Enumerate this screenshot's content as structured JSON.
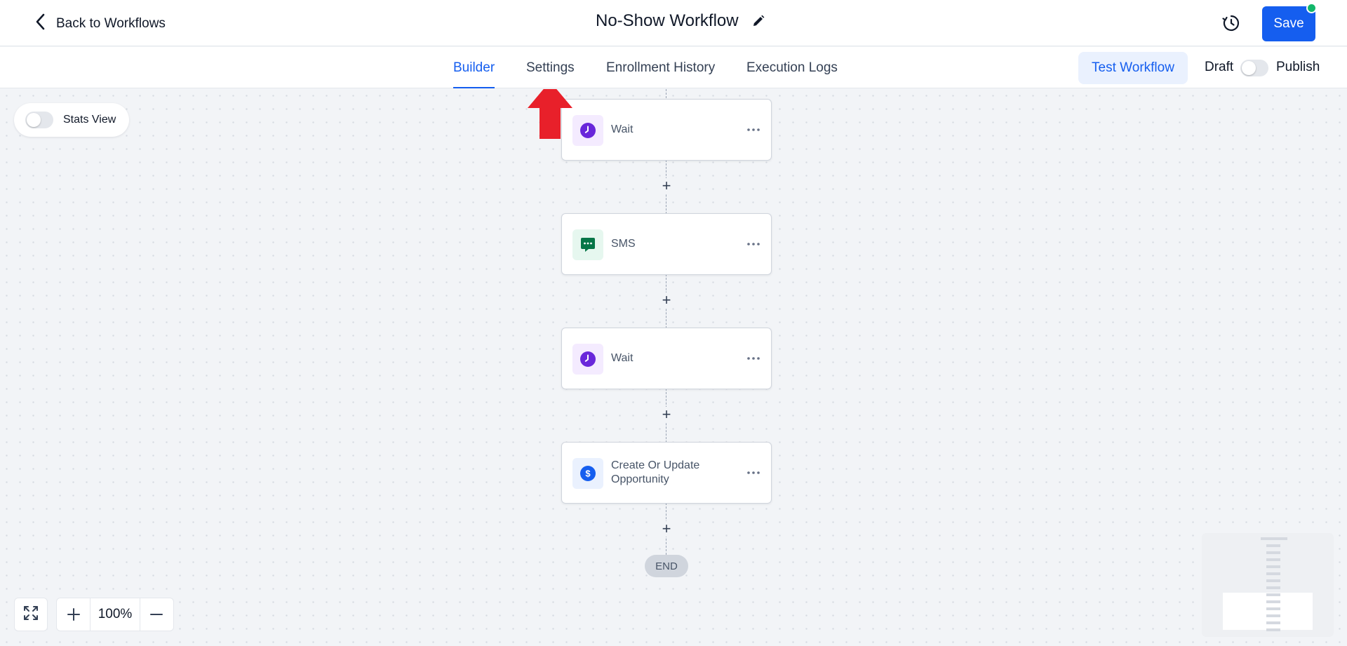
{
  "header": {
    "back_label": "Back to Workflows",
    "title": "No-Show Workflow",
    "save_label": "Save"
  },
  "tabs": [
    {
      "label": "Builder",
      "active": true
    },
    {
      "label": "Settings",
      "active": false
    },
    {
      "label": "Enrollment History",
      "active": false
    },
    {
      "label": "Execution Logs",
      "active": false
    }
  ],
  "actions": {
    "test_label": "Test Workflow",
    "draft_label": "Draft",
    "publish_label": "Publish",
    "publish_toggle_on": false
  },
  "canvas": {
    "stats_view_label": "Stats View",
    "stats_view_on": false,
    "nodes": [
      {
        "label": "Wait",
        "icon": "clock-icon"
      },
      {
        "label": "SMS",
        "icon": "sms-chat-icon"
      },
      {
        "label": "Wait",
        "icon": "clock-icon"
      },
      {
        "label": "Create Or Update Opportunity",
        "icon": "dollar-icon"
      }
    ],
    "end_label": "END",
    "zoom": "100%"
  },
  "colors": {
    "accent": "#155eef",
    "wait_icon": "#6927da",
    "sms_icon": "#067647",
    "status_dot": "#12b76a",
    "annotation_arrow": "#e8202a"
  }
}
